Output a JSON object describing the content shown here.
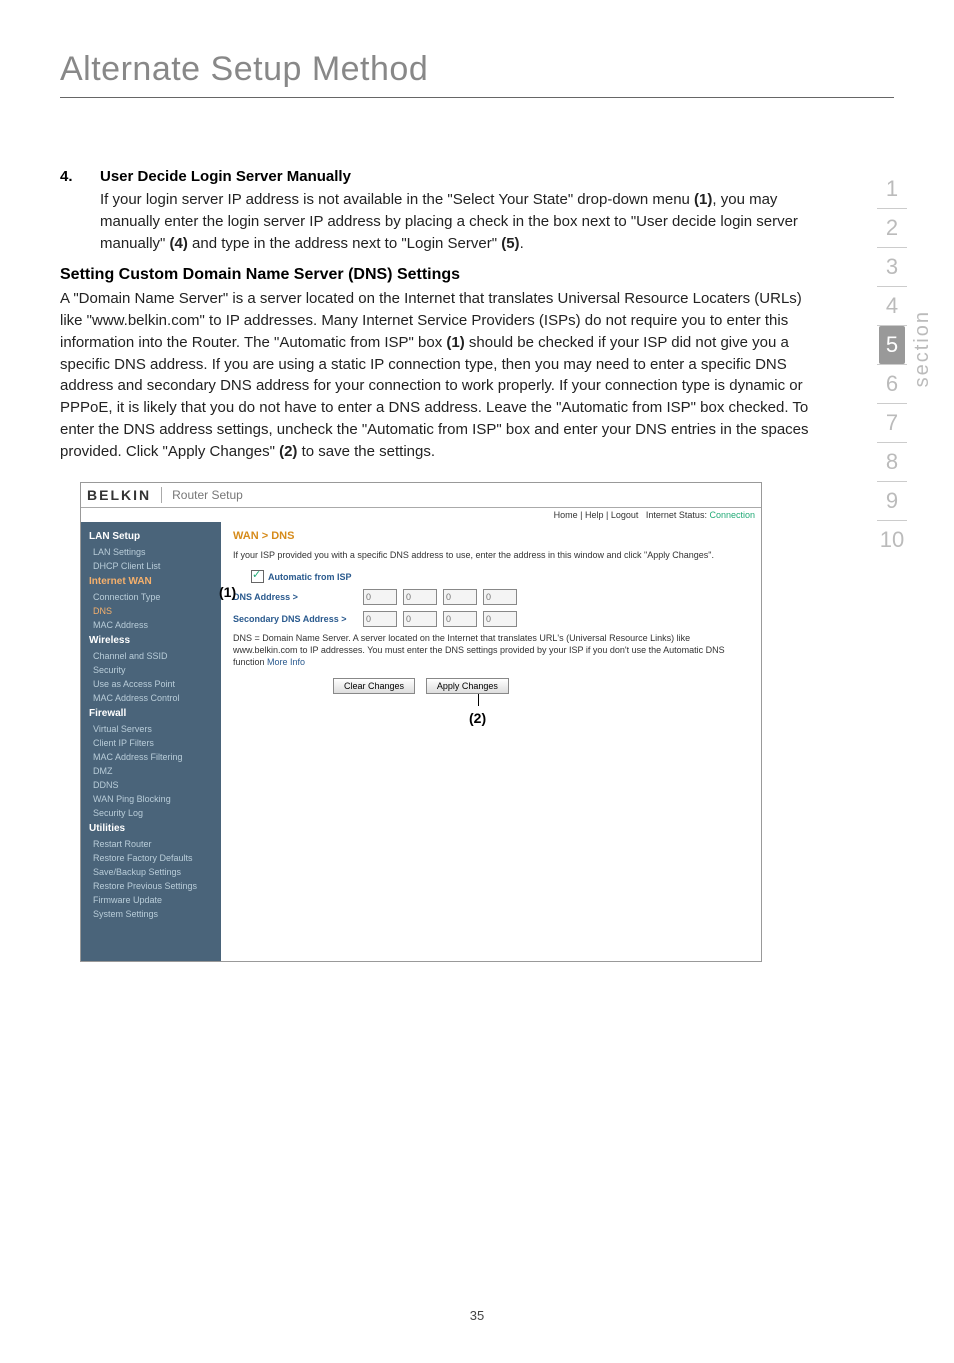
{
  "header": {
    "title": "Alternate Setup Method"
  },
  "item4": {
    "num": "4.",
    "heading": "User Decide Login Server Manually",
    "text_before_ref1": "If your login server IP address is not available in the \"Select Your State\" drop-down menu ",
    "ref1": "(1)",
    "text_mid": ", you may manually enter the login server IP address by placing a check in the box next to \"User decide login server manually\" ",
    "ref4": "(4)",
    "text_mid2": " and type in the address next to \"Login Server\" ",
    "ref5": "(5)",
    "text_end": "."
  },
  "dns_section": {
    "heading": "Setting Custom Domain Name Server (DNS) Settings",
    "text_a": "A \"Domain Name Server\" is a server located on the Internet that translates Universal Resource Locaters (URLs) like \"www.belkin.com\" to IP addresses. Many Internet Service Providers (ISPs) do not require you to enter this information into the Router. The \"Automatic from ISP\" box ",
    "ref1": "(1)",
    "text_b": " should be checked if your ISP did not give you a specific DNS address. If you are using a static IP connection type, then you may need to enter a specific DNS address and secondary DNS address for your connection to work properly. If your connection type is dynamic or PPPoE, it is likely that you do not have to enter a DNS address. Leave the \"Automatic from ISP\" box checked. To enter the DNS address settings, uncheck the \"Automatic from ISP\" box and enter your DNS entries in the spaces provided. Click \"Apply Changes\" ",
    "ref2": "(2)",
    "text_c": " to save the settings."
  },
  "side_nav": {
    "items": [
      "1",
      "2",
      "3",
      "4",
      "5",
      "6",
      "7",
      "8",
      "9",
      "10"
    ],
    "active_index": 4,
    "label": "section"
  },
  "router": {
    "logo": "BELKIN",
    "title": "Router Setup",
    "meta_links": "Home | Help | Logout",
    "meta_status_label": "Internet Status: ",
    "meta_status_value": "Connection",
    "breadcrumb": "WAN > DNS",
    "intro": "If your ISP provided you with a specific DNS address to use, enter the address in this window and click \"Apply Changes\".",
    "auto_label": "Automatic from ISP",
    "dns_label": "DNS Address >",
    "dns2_label": "Secondary DNS Address >",
    "ip_placeholder": "0",
    "note": "DNS = Domain Name Server. A server located on the Internet that translates URL's (Universal Resource Links) like www.belkin.com to IP addresses. You must enter the DNS settings provided by your ISP if you don't use the Automatic DNS function ",
    "note_link": "More Info",
    "btn_clear": "Clear Changes",
    "btn_apply": "Apply Changes",
    "callout1": "(1)",
    "callout2": "(2)",
    "sidebar": {
      "groups": [
        {
          "label": "LAN Setup",
          "links": [
            "LAN Settings",
            "DHCP Client List"
          ]
        },
        {
          "label": "Internet WAN",
          "links": [
            "Connection Type",
            "DNS",
            "MAC Address"
          ]
        },
        {
          "label": "Wireless",
          "links": [
            "Channel and SSID",
            "Security",
            "Use as Access Point",
            "MAC Address Control"
          ]
        },
        {
          "label": "Firewall",
          "links": [
            "Virtual Servers",
            "Client IP Filters",
            "MAC Address Filtering",
            "DMZ",
            "DDNS",
            "WAN Ping Blocking",
            "Security Log"
          ]
        },
        {
          "label": "Utilities",
          "links": [
            "Restart Router",
            "Restore Factory Defaults",
            "Save/Backup Settings",
            "Restore Previous Settings",
            "Firmware Update",
            "System Settings"
          ]
        }
      ]
    }
  },
  "page_number": "35"
}
